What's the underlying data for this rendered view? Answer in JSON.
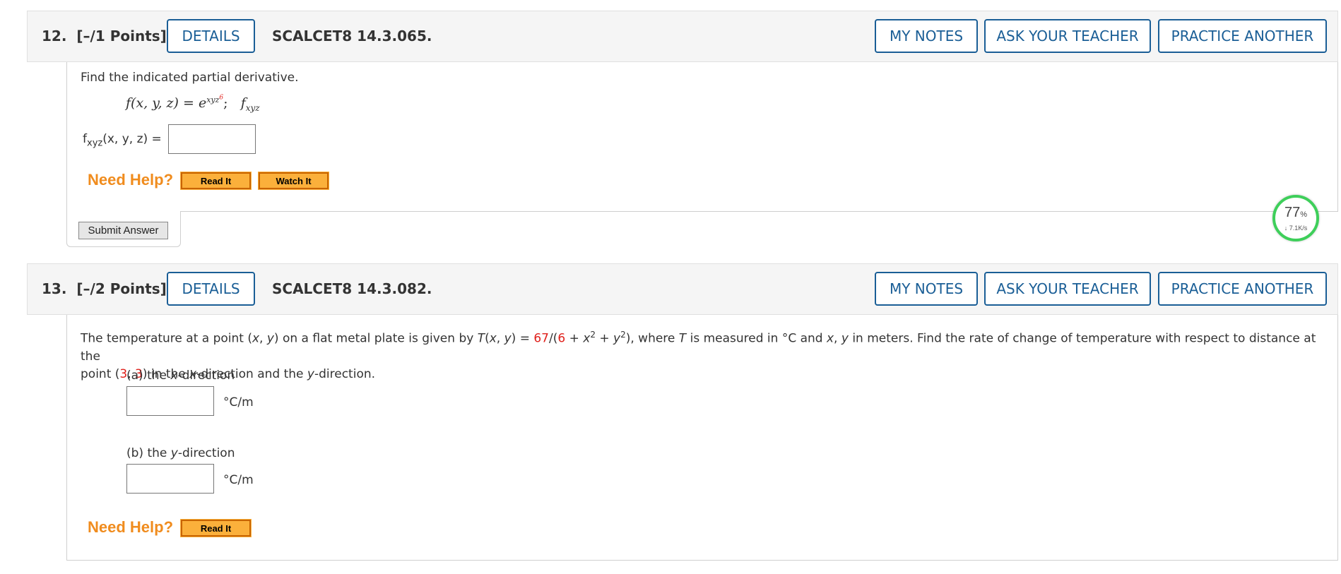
{
  "q12": {
    "number": "12.",
    "points": "[–/1 Points]",
    "details_label": "DETAILS",
    "id": "SCALCET8 14.3.065.",
    "notes_label": "MY NOTES",
    "ask_label": "ASK YOUR TEACHER",
    "practice_label": "PRACTICE ANOTHER",
    "instruction": "Find the indicated partial derivative.",
    "formula_lhs": "f(x, y, z) = e",
    "formula_exp": "xyz",
    "formula_exp_power": "6",
    "formula_sep": ";",
    "formula_target": "f",
    "formula_target_sub": "xyz",
    "answer_prefix": "f",
    "answer_prefix_sub": "xyz",
    "answer_args": "(x, y, z) =",
    "need_help": "Need Help?",
    "read_it": "Read It",
    "watch_it": "Watch It",
    "submit": "Submit Answer"
  },
  "q13": {
    "number": "13.",
    "points": "[–/2 Points]",
    "details_label": "DETAILS",
    "id": "SCALCET8 14.3.082.",
    "notes_label": "MY NOTES",
    "ask_label": "ASK YOUR TEACHER",
    "practice_label": "PRACTICE ANOTHER",
    "text_1": "The temperature at a point (",
    "x_var": "x",
    "comma": ", ",
    "y_var": "y",
    "text_2": ") on a flat metal plate is given by ",
    "T_var": "T",
    "text_3": "(",
    "text_4": ") = ",
    "num_67": "67",
    "slash": "/(",
    "num_6": "6",
    "plus": " + ",
    "sq": "2",
    "text_5": "), where ",
    "text_6": " is measured in °C and ",
    "text_7": " in meters. Find the rate of change of temperature with respect to distance at the",
    "line2_a": "point (",
    "pt_x": "3",
    "pt_y": "3",
    "line2_b": ") in the ",
    "line2_c": "-direction and the ",
    "line2_d": "-direction.",
    "part_a_label": "(a) the ",
    "part_a_var": "x",
    "part_a_suffix": "-direction",
    "part_b_label": "(b) the ",
    "part_b_var": "y",
    "part_b_suffix": "-direction",
    "unit": "°C/m",
    "need_help": "Need Help?",
    "read_it": "Read It"
  },
  "gauge": {
    "percent": "77",
    "percent_sign": "%",
    "rate": "↓ 7.1K/s",
    "level": 0.77,
    "accent": "#3ecf5a"
  },
  "colors": {
    "link_blue": "#1a5e96",
    "help_orange": "#f08c1e",
    "highlight_red": "#e0201b"
  }
}
